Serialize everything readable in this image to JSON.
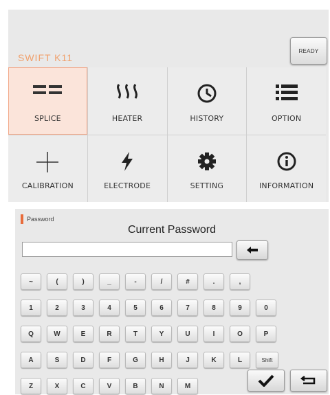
{
  "menu": {
    "status_button": "READY",
    "brand": "SWIFT K11",
    "tiles": [
      {
        "label": "SPLICE",
        "icon": "splice-icon"
      },
      {
        "label": "HEATER",
        "icon": "heater-icon"
      },
      {
        "label": "HISTORY",
        "icon": "clock-icon"
      },
      {
        "label": "OPTION",
        "icon": "list-icon"
      },
      {
        "label": "CALIBRATION",
        "icon": "crosshair-icon"
      },
      {
        "label": "ELECTRODE",
        "icon": "lightning-icon"
      },
      {
        "label": "SETTING",
        "icon": "gear-icon"
      },
      {
        "label": "INFORMATION",
        "icon": "info-icon"
      }
    ],
    "selected_tile": "SPLICE",
    "accent_color": "#e86c3b"
  },
  "password": {
    "tag": "Password",
    "title": "Current Password",
    "value": "",
    "backspace_icon": "backspace-arrow-icon",
    "confirm_icon": "checkmark-icon",
    "return_icon": "return-icon",
    "keys": {
      "row1": [
        "~",
        "(",
        ")",
        "_",
        "-",
        "/",
        "#",
        ".",
        ","
      ],
      "row2": [
        "1",
        "2",
        "3",
        "4",
        "5",
        "6",
        "7",
        "8",
        "9",
        "0"
      ],
      "row3": [
        "Q",
        "W",
        "E",
        "R",
        "T",
        "Y",
        "U",
        "I",
        "O",
        "P"
      ],
      "row4": [
        "A",
        "S",
        "D",
        "F",
        "G",
        "H",
        "J",
        "K",
        "L",
        "Shift"
      ],
      "row5": [
        "Z",
        "X",
        "C",
        "V",
        "B",
        "N",
        "M"
      ]
    }
  }
}
